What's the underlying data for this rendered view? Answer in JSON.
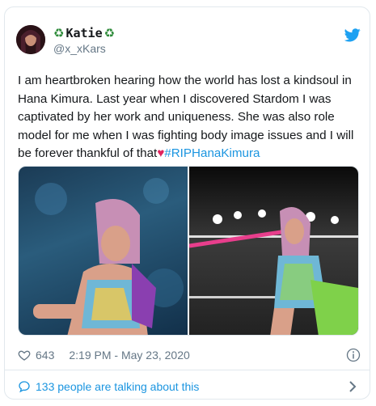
{
  "tweet": {
    "display_name": "Katie",
    "name_emoji": "♻",
    "handle": "@x_xKars",
    "text_main": "I am heartbroken hearing how the world has lost a kindsoul in Hana Kimura. Last year when I discovered Stardom I was captivated by her work and uniqueness. She was also role model for me when I was fighting body image issues and I will be forever thankful of that",
    "heart_emoji": "♥",
    "hashtag": "#RIPHanaKimura",
    "likes": "643",
    "timestamp": "2:19 PM - May 23, 2020",
    "talking_label": "133 people are talking about this"
  },
  "media": {
    "photos": [
      {
        "alt": "photo-left"
      },
      {
        "alt": "photo-right"
      }
    ]
  },
  "colors": {
    "link": "#1b95e0",
    "heart": "#e0245e",
    "muted": "#657786",
    "recycle_green": "#2e8b3a"
  },
  "icons": {
    "brand": "twitter-bird-icon",
    "like": "heart-outline-icon",
    "info": "info-icon",
    "conversation": "speech-bubble-icon",
    "more": "chevron-right-icon"
  }
}
